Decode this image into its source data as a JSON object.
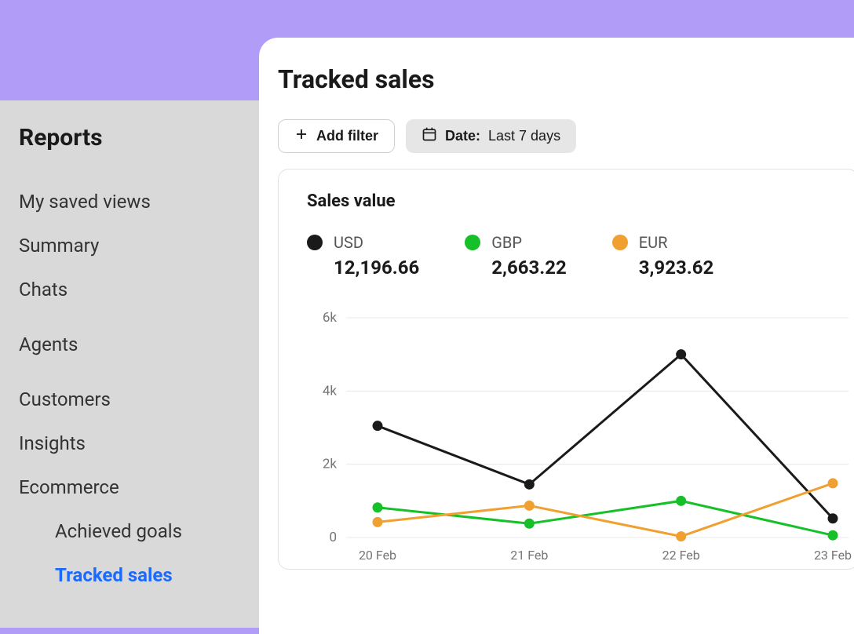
{
  "sidebar": {
    "title": "Reports",
    "items": [
      {
        "label": "My saved views"
      },
      {
        "label": "Summary"
      },
      {
        "label": "Chats"
      },
      {
        "label": "Agents"
      },
      {
        "label": "Customers"
      },
      {
        "label": "Insights"
      },
      {
        "label": "Ecommerce",
        "children": [
          {
            "label": "Achieved goals",
            "active": false
          },
          {
            "label": "Tracked sales",
            "active": true
          }
        ]
      }
    ]
  },
  "main": {
    "title": "Tracked sales",
    "filters": {
      "add_label": "Add filter",
      "date_label": "Date:",
      "date_value": "Last 7 days"
    },
    "card": {
      "title": "Sales value",
      "legend": [
        {
          "label": "USD",
          "value": "12,196.66",
          "color": "#1a1a1a"
        },
        {
          "label": "GBP",
          "value": "2,663.22",
          "color": "#16c028"
        },
        {
          "label": "EUR",
          "value": "3,923.62",
          "color": "#f0a030"
        }
      ]
    }
  },
  "chart_data": {
    "type": "line",
    "categories": [
      "20 Feb",
      "21 Feb",
      "22 Feb",
      "23 Feb"
    ],
    "series": [
      {
        "name": "USD",
        "color": "#1a1a1a",
        "values": [
          3050,
          1450,
          5000,
          520
        ]
      },
      {
        "name": "GBP",
        "color": "#16c028",
        "values": [
          820,
          380,
          1000,
          60
        ]
      },
      {
        "name": "EUR",
        "color": "#f0a030",
        "values": [
          420,
          870,
          30,
          1480
        ]
      }
    ],
    "y_ticks": [
      0,
      2000,
      4000,
      6000
    ],
    "y_tick_labels": [
      "0",
      "2k",
      "4k",
      "6k"
    ],
    "ylim": [
      0,
      6000
    ],
    "xlabel": "",
    "ylabel": "",
    "title": "Sales value"
  }
}
